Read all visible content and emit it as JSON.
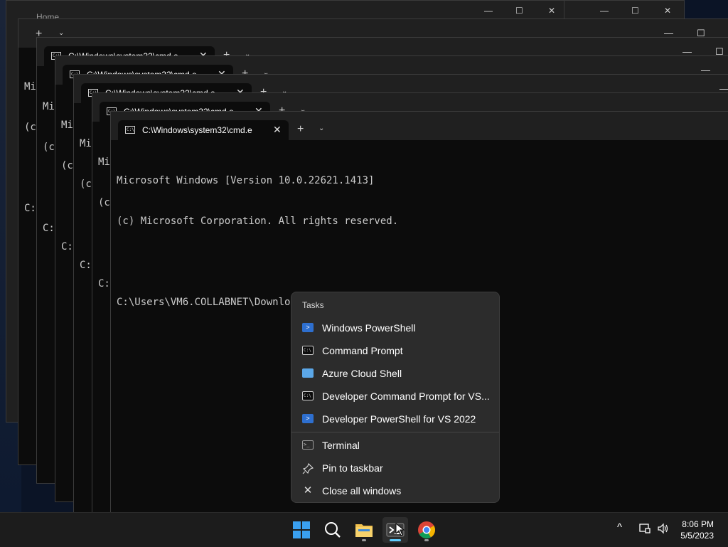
{
  "background_windows": {
    "home_tab_title": "Home",
    "stack_tab_title": "C:\\Windows\\system32\\cmd.e",
    "partial_lines": [
      "Mi",
      "(c",
      "C:"
    ]
  },
  "terminal": {
    "tab_title": "C:\\Windows\\system32\\cmd.e",
    "new_tab_glyph": "+",
    "dropdown_glyph": "⌄",
    "close_glyph": "✕",
    "lines": [
      "Microsoft Windows [Version 10.0.22621.1413]",
      "(c) Microsoft Corporation. All rights reserved.",
      "",
      "C:\\Users\\VM6.COLLABNET\\Downloads>"
    ]
  },
  "jumplist": {
    "header": "Tasks",
    "tasks": [
      {
        "label": "Windows PowerShell",
        "icon": "powershell-icon"
      },
      {
        "label": "Command Prompt",
        "icon": "command-prompt-icon"
      },
      {
        "label": "Azure Cloud Shell",
        "icon": "azure-cloud-shell-icon"
      },
      {
        "label": "Developer Command Prompt for VS...",
        "icon": "command-prompt-icon"
      },
      {
        "label": "Developer PowerShell for VS 2022",
        "icon": "powershell-icon"
      }
    ],
    "actions": [
      {
        "label": "Terminal",
        "icon": "terminal-icon"
      },
      {
        "label": "Pin to taskbar",
        "icon": "pin-icon"
      },
      {
        "label": "Close all windows",
        "icon": "close-icon"
      }
    ]
  },
  "taskbar": {
    "time": "8:06 PM",
    "date": "5/5/2023",
    "accent": "#60cdff"
  }
}
